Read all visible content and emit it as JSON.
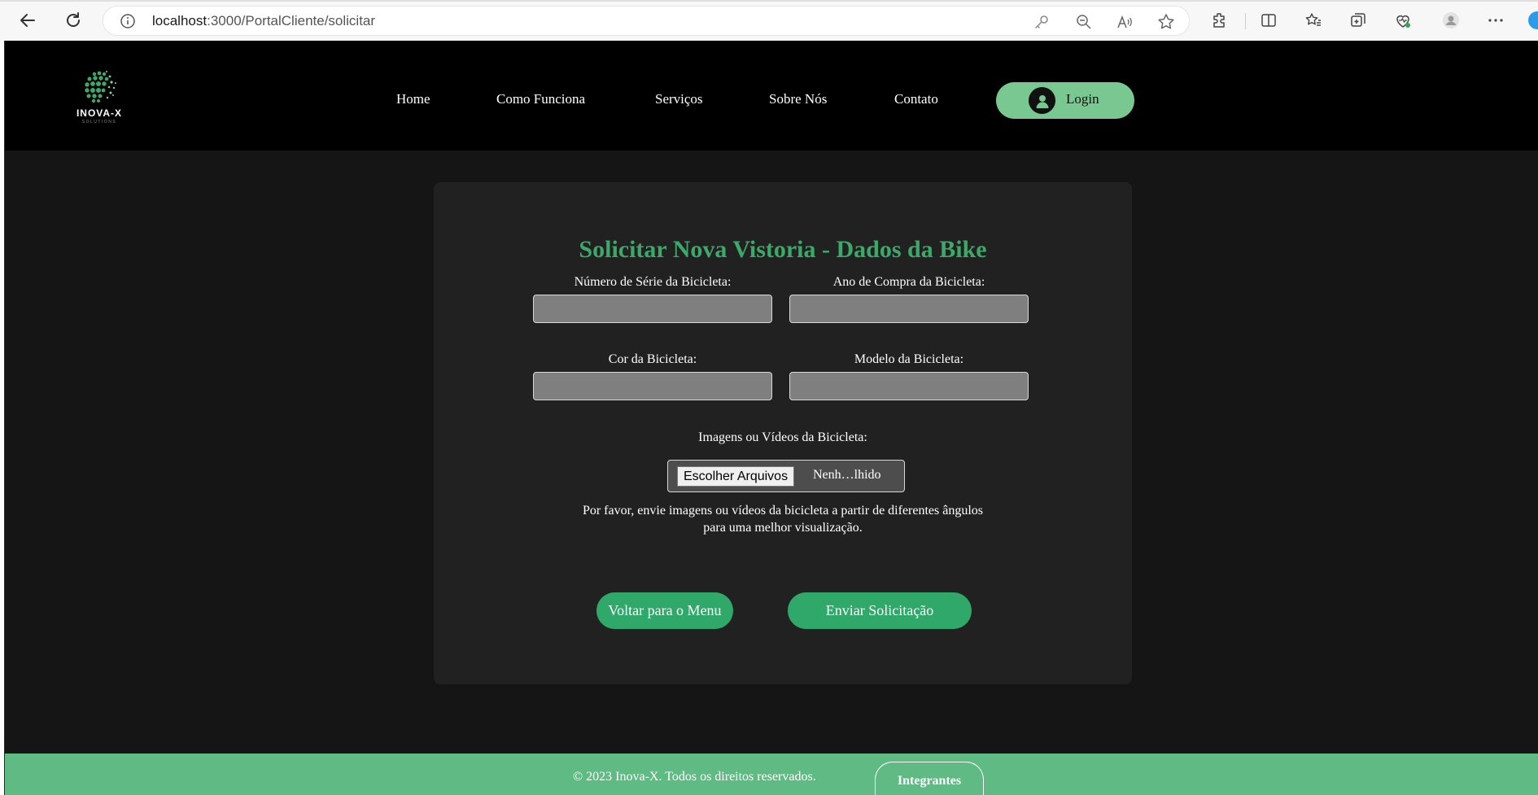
{
  "browser": {
    "url_host": "localhost",
    "url_path": ":3000/PortalCliente/solicitar"
  },
  "header": {
    "logo_text": "INOVA-X",
    "logo_sub": "SOLUTIONS",
    "nav": [
      "Home",
      "Como Funciona",
      "Serviços",
      "Sobre Nós",
      "Contato"
    ],
    "login_label": "Login"
  },
  "form": {
    "title": "Solicitar Nova Vistoria - Dados da Bike",
    "serial_label": "Número de Série da Bicicleta:",
    "serial_value": "",
    "year_label": "Ano de Compra da Bicicleta:",
    "year_value": "",
    "color_label": "Cor da Bicicleta:",
    "color_value": "",
    "model_label": "Modelo da Bicicleta:",
    "model_value": "",
    "media_label": "Imagens ou Vídeos da Bicicleta:",
    "file_button": "Escolher Arquivos",
    "file_status": "Nenh…lhido",
    "hint_line1": "Por favor, envie imagens ou vídeos da bicicleta a partir de diferentes ângulos",
    "hint_line2": "para uma melhor visualização.",
    "back_button": "Voltar para o Menu",
    "submit_button": "Enviar Solicitação"
  },
  "footer": {
    "copyright": "© 2023 Inova-X. Todos os direitos reservados.",
    "team_button": "Integrantes"
  },
  "colors": {
    "accent_green": "#3ea86a",
    "button_green": "#2fa86a",
    "login_green": "#7ac891",
    "footer_green": "#5fba83",
    "card_bg": "#212121",
    "page_bg": "#151515"
  }
}
